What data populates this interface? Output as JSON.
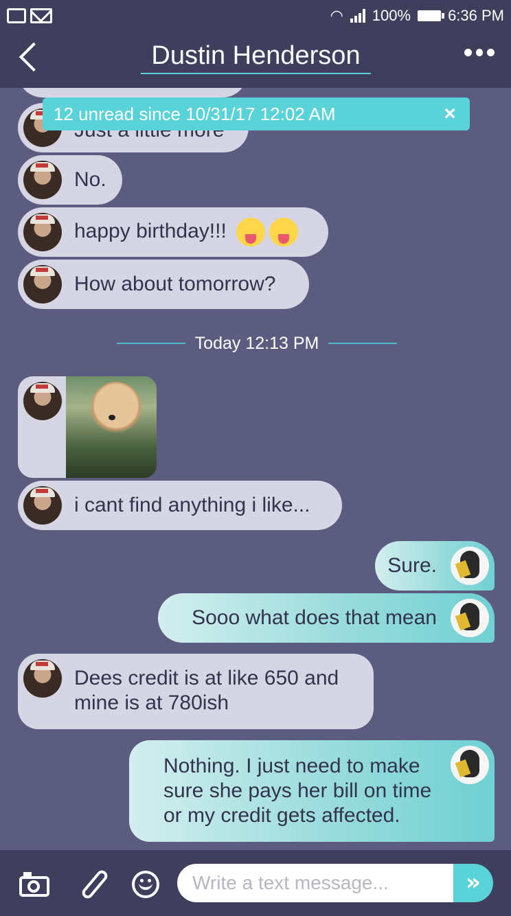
{
  "status_bar": {
    "battery": "100%",
    "time": "6:36 PM"
  },
  "header": {
    "title": "Dustin Henderson"
  },
  "unread": {
    "text": "12 unread since 10/31/17 12:02 AM",
    "close": "×"
  },
  "messages_before": [
    {
      "text": "Just a little more"
    },
    {
      "text": "No."
    },
    {
      "text": "happy birthday!!!"
    },
    {
      "text": "How about tomorrow?"
    }
  ],
  "divider": {
    "label": "Today 12:13 PM"
  },
  "messages_after": [
    {
      "from": "them",
      "text": "i cant find anything i like..."
    },
    {
      "from": "me",
      "text": "Sure."
    },
    {
      "from": "me",
      "text": "Sooo what does that mean"
    },
    {
      "from": "them",
      "text": "Dees credit is at like 650 and mine is at 780ish"
    },
    {
      "from": "me",
      "text": "Nothing. I just need to make sure she pays her bill on time or my credit gets affected."
    }
  ],
  "input": {
    "placeholder": "Write a text message...",
    "send": "»"
  },
  "colors": {
    "header_bg": "#3f3e5c",
    "chat_bg": "#5c5b80",
    "accent": "#5ad3d8",
    "incoming_bubble": "#d6d5e3"
  }
}
